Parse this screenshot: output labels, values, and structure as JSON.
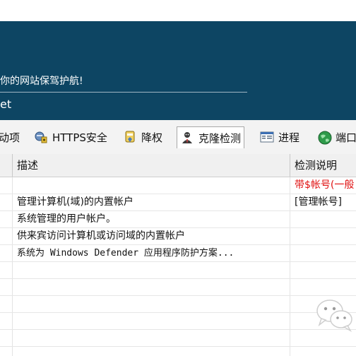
{
  "banner": {
    "slogan": "你的网站保驾护航!",
    "brand_tail": "et"
  },
  "tabs": [
    {
      "label": "动项",
      "icon": "startup-icon"
    },
    {
      "label": "HTTPS安全",
      "icon": "network-shield-icon"
    },
    {
      "label": "降权",
      "icon": "shield-badge-icon"
    },
    {
      "label": "克隆检测",
      "icon": "user-clone-icon",
      "active": true
    },
    {
      "label": "进程",
      "icon": "window-list-icon"
    },
    {
      "label": "端口",
      "icon": "globe-icon"
    }
  ],
  "table": {
    "columns": [
      "",
      "描述",
      "检测说明"
    ],
    "rows": [
      {
        "description": "",
        "note": "带$帐号(一般"
      },
      {
        "description": "管理计算机(域)的内置帐户",
        "note": "[管理帐号]"
      },
      {
        "description": "系统管理的用户帐户。",
        "note": ""
      },
      {
        "description": "供来宾访问计算机或访问域的内置帐户",
        "note": ""
      },
      {
        "description": "系统为 Windows Defender 应用程序防护方案...",
        "note": ""
      }
    ]
  },
  "colors": {
    "banner": "#0d4563",
    "warning_text": "#e01010",
    "header_bg": "#f0f0f0"
  },
  "watermark": {
    "icon": "wechat-icon"
  }
}
